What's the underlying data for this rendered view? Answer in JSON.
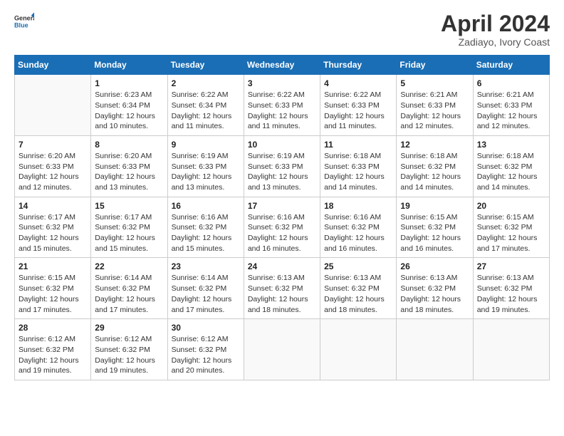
{
  "logo": {
    "line1": "General",
    "line2": "Blue"
  },
  "title": "April 2024",
  "subtitle": "Zadiayo, Ivory Coast",
  "weekdays": [
    "Sunday",
    "Monday",
    "Tuesday",
    "Wednesday",
    "Thursday",
    "Friday",
    "Saturday"
  ],
  "weeks": [
    [
      {
        "num": "",
        "detail": ""
      },
      {
        "num": "1",
        "detail": "Sunrise: 6:23 AM\nSunset: 6:34 PM\nDaylight: 12 hours\nand 10 minutes."
      },
      {
        "num": "2",
        "detail": "Sunrise: 6:22 AM\nSunset: 6:34 PM\nDaylight: 12 hours\nand 11 minutes."
      },
      {
        "num": "3",
        "detail": "Sunrise: 6:22 AM\nSunset: 6:33 PM\nDaylight: 12 hours\nand 11 minutes."
      },
      {
        "num": "4",
        "detail": "Sunrise: 6:22 AM\nSunset: 6:33 PM\nDaylight: 12 hours\nand 11 minutes."
      },
      {
        "num": "5",
        "detail": "Sunrise: 6:21 AM\nSunset: 6:33 PM\nDaylight: 12 hours\nand 12 minutes."
      },
      {
        "num": "6",
        "detail": "Sunrise: 6:21 AM\nSunset: 6:33 PM\nDaylight: 12 hours\nand 12 minutes."
      }
    ],
    [
      {
        "num": "7",
        "detail": "Sunrise: 6:20 AM\nSunset: 6:33 PM\nDaylight: 12 hours\nand 12 minutes."
      },
      {
        "num": "8",
        "detail": "Sunrise: 6:20 AM\nSunset: 6:33 PM\nDaylight: 12 hours\nand 13 minutes."
      },
      {
        "num": "9",
        "detail": "Sunrise: 6:19 AM\nSunset: 6:33 PM\nDaylight: 12 hours\nand 13 minutes."
      },
      {
        "num": "10",
        "detail": "Sunrise: 6:19 AM\nSunset: 6:33 PM\nDaylight: 12 hours\nand 13 minutes."
      },
      {
        "num": "11",
        "detail": "Sunrise: 6:18 AM\nSunset: 6:33 PM\nDaylight: 12 hours\nand 14 minutes."
      },
      {
        "num": "12",
        "detail": "Sunrise: 6:18 AM\nSunset: 6:32 PM\nDaylight: 12 hours\nand 14 minutes."
      },
      {
        "num": "13",
        "detail": "Sunrise: 6:18 AM\nSunset: 6:32 PM\nDaylight: 12 hours\nand 14 minutes."
      }
    ],
    [
      {
        "num": "14",
        "detail": "Sunrise: 6:17 AM\nSunset: 6:32 PM\nDaylight: 12 hours\nand 15 minutes."
      },
      {
        "num": "15",
        "detail": "Sunrise: 6:17 AM\nSunset: 6:32 PM\nDaylight: 12 hours\nand 15 minutes."
      },
      {
        "num": "16",
        "detail": "Sunrise: 6:16 AM\nSunset: 6:32 PM\nDaylight: 12 hours\nand 15 minutes."
      },
      {
        "num": "17",
        "detail": "Sunrise: 6:16 AM\nSunset: 6:32 PM\nDaylight: 12 hours\nand 16 minutes."
      },
      {
        "num": "18",
        "detail": "Sunrise: 6:16 AM\nSunset: 6:32 PM\nDaylight: 12 hours\nand 16 minutes."
      },
      {
        "num": "19",
        "detail": "Sunrise: 6:15 AM\nSunset: 6:32 PM\nDaylight: 12 hours\nand 16 minutes."
      },
      {
        "num": "20",
        "detail": "Sunrise: 6:15 AM\nSunset: 6:32 PM\nDaylight: 12 hours\nand 17 minutes."
      }
    ],
    [
      {
        "num": "21",
        "detail": "Sunrise: 6:15 AM\nSunset: 6:32 PM\nDaylight: 12 hours\nand 17 minutes."
      },
      {
        "num": "22",
        "detail": "Sunrise: 6:14 AM\nSunset: 6:32 PM\nDaylight: 12 hours\nand 17 minutes."
      },
      {
        "num": "23",
        "detail": "Sunrise: 6:14 AM\nSunset: 6:32 PM\nDaylight: 12 hours\nand 17 minutes."
      },
      {
        "num": "24",
        "detail": "Sunrise: 6:13 AM\nSunset: 6:32 PM\nDaylight: 12 hours\nand 18 minutes."
      },
      {
        "num": "25",
        "detail": "Sunrise: 6:13 AM\nSunset: 6:32 PM\nDaylight: 12 hours\nand 18 minutes."
      },
      {
        "num": "26",
        "detail": "Sunrise: 6:13 AM\nSunset: 6:32 PM\nDaylight: 12 hours\nand 18 minutes."
      },
      {
        "num": "27",
        "detail": "Sunrise: 6:13 AM\nSunset: 6:32 PM\nDaylight: 12 hours\nand 19 minutes."
      }
    ],
    [
      {
        "num": "28",
        "detail": "Sunrise: 6:12 AM\nSunset: 6:32 PM\nDaylight: 12 hours\nand 19 minutes."
      },
      {
        "num": "29",
        "detail": "Sunrise: 6:12 AM\nSunset: 6:32 PM\nDaylight: 12 hours\nand 19 minutes."
      },
      {
        "num": "30",
        "detail": "Sunrise: 6:12 AM\nSunset: 6:32 PM\nDaylight: 12 hours\nand 20 minutes."
      },
      {
        "num": "",
        "detail": ""
      },
      {
        "num": "",
        "detail": ""
      },
      {
        "num": "",
        "detail": ""
      },
      {
        "num": "",
        "detail": ""
      }
    ]
  ]
}
